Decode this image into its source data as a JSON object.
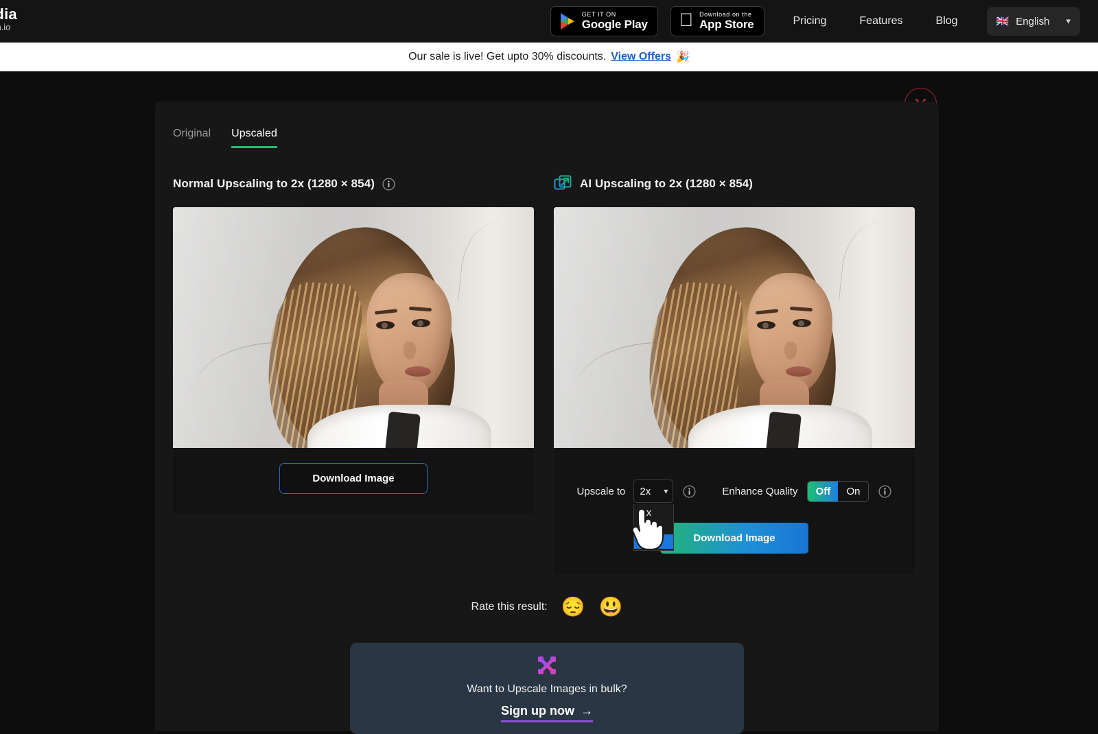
{
  "brand": {
    "name_main": "edia",
    "name_sub": "lBin.io"
  },
  "nav": {
    "google_play": {
      "line1": "GET IT ON",
      "line2": "Google Play",
      "icon": "google-play-icon"
    },
    "app_store": {
      "line1": "Download on the",
      "line2": "App Store",
      "icon": "apple-icon"
    },
    "links": [
      {
        "label": "Pricing"
      },
      {
        "label": "Features"
      },
      {
        "label": "Blog"
      }
    ],
    "language": {
      "flag": "🇬🇧",
      "label": "English",
      "chevron": "chevron-down-icon"
    }
  },
  "banner": {
    "text": "Our sale is live! Get upto 30% discounts.",
    "link_label": "View Offers",
    "emoji": "🎉"
  },
  "modal": {
    "close_label": "close-icon",
    "tabs": [
      {
        "label": "Original",
        "active": false
      },
      {
        "label": "Upscaled",
        "active": true
      }
    ],
    "left_panel": {
      "title": "Normal Upscaling to 2x (1280 × 854)",
      "info_icon": "info-icon",
      "download_label": "Download Image"
    },
    "right_panel": {
      "title": "AI Upscaling to 2x (1280 × 854)",
      "title_icon": "ai-expand-icon",
      "upscale_label": "Upscale to",
      "upscale_value": "2x",
      "upscale_options": [
        {
          "label": "1x",
          "selected": false
        },
        {
          "label": "2x",
          "selected": false
        },
        {
          "label": "4x",
          "selected": true
        }
      ],
      "upscale_info_icon": "info-icon",
      "enhance_label": "Enhance Quality",
      "enhance_off": "Off",
      "enhance_on": "On",
      "enhance_state": "Off",
      "enhance_info_icon": "info-icon",
      "download_label": "Download Image"
    }
  },
  "rate": {
    "label": "Rate this result:",
    "sad_emoji": "😔",
    "happy_emoji": "😃"
  },
  "bulk": {
    "icon": "bulk-upscale-icon",
    "question": "Want to Upscale Images in bulk?",
    "cta": "Sign up now",
    "arrow": "→"
  },
  "colors": {
    "page_bg": "#0d0d0d",
    "nav_bg": "#141414",
    "modal_bg": "#171717",
    "card_bg": "#131313",
    "tab_active_underline": "#2eb872",
    "banner_link": "#1f5fbf",
    "close_red": "#a32235",
    "dropdown_highlight": "#1878db",
    "gradient_green": "#22b573",
    "gradient_blue": "#1976d2",
    "bulk_card_bg": "#2a3643",
    "bulk_underline": "#8b4fd6"
  }
}
